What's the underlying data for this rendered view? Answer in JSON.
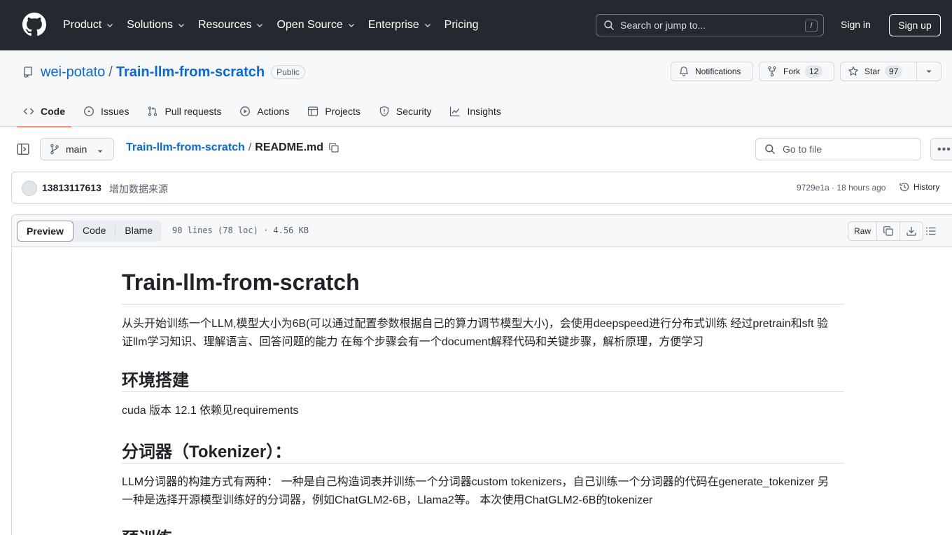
{
  "header": {
    "nav": [
      "Product",
      "Solutions",
      "Resources",
      "Open Source",
      "Enterprise",
      "Pricing"
    ],
    "search_placeholder": "Search or jump to...",
    "search_key": "/",
    "sign_in": "Sign in",
    "sign_up": "Sign up"
  },
  "repo": {
    "owner": "wei-potato",
    "separator": "/",
    "name": "Train-llm-from-scratch",
    "visibility": "Public",
    "notifications_label": "Notifications",
    "fork_label": "Fork",
    "fork_count": "12",
    "star_label": "Star",
    "star_count": "97"
  },
  "tabs": [
    "Code",
    "Issues",
    "Pull requests",
    "Actions",
    "Projects",
    "Security",
    "Insights"
  ],
  "file_bar": {
    "branch": "main",
    "crumb_repo": "Train-llm-from-scratch",
    "crumb_sep": "/",
    "crumb_file": "README.md",
    "goto_placeholder": "Go to file"
  },
  "commit": {
    "author": "13813117613",
    "message": "增加数据来源",
    "meta": "9729e1a · 18 hours ago",
    "history": "History"
  },
  "file_view": {
    "views": [
      "Preview",
      "Code",
      "Blame"
    ],
    "stats": "90 lines (78 loc) · 4.56 KB",
    "raw": "Raw"
  },
  "readme": {
    "title": "Train-llm-from-scratch",
    "intro_line1": "从头开始训练一个LLM,模型大小为6B(可以通过配置参数根据自己的算力调节模型大小)，会使用deepspeed进行分布式训练 经过pretrain和sft 验",
    "intro_line2": "证llm学习知识、理解语言、回答问题的能力 在每个步骤会有一个document解释代码和关键步骤，解析原理，方便学习",
    "h_env": "环境搭建",
    "env_text": "cuda 版本 12.1 依赖见requirements",
    "h_tokenizer": "分词器（Tokenizer）：",
    "tok_line1": "LLM分词器的构建方式有两种： 一种是自己构造词表并训练一个分词器custom tokenizers，自己训练一个分词器的代码在generate_tokenizer 另",
    "tok_line2": "一种是选择开源模型训练好的分词器，例如ChatGLM2-6B，Llama2等。 本次使用ChatGLM2-6B的tokenizer",
    "h_pretrain": "预训练"
  }
}
